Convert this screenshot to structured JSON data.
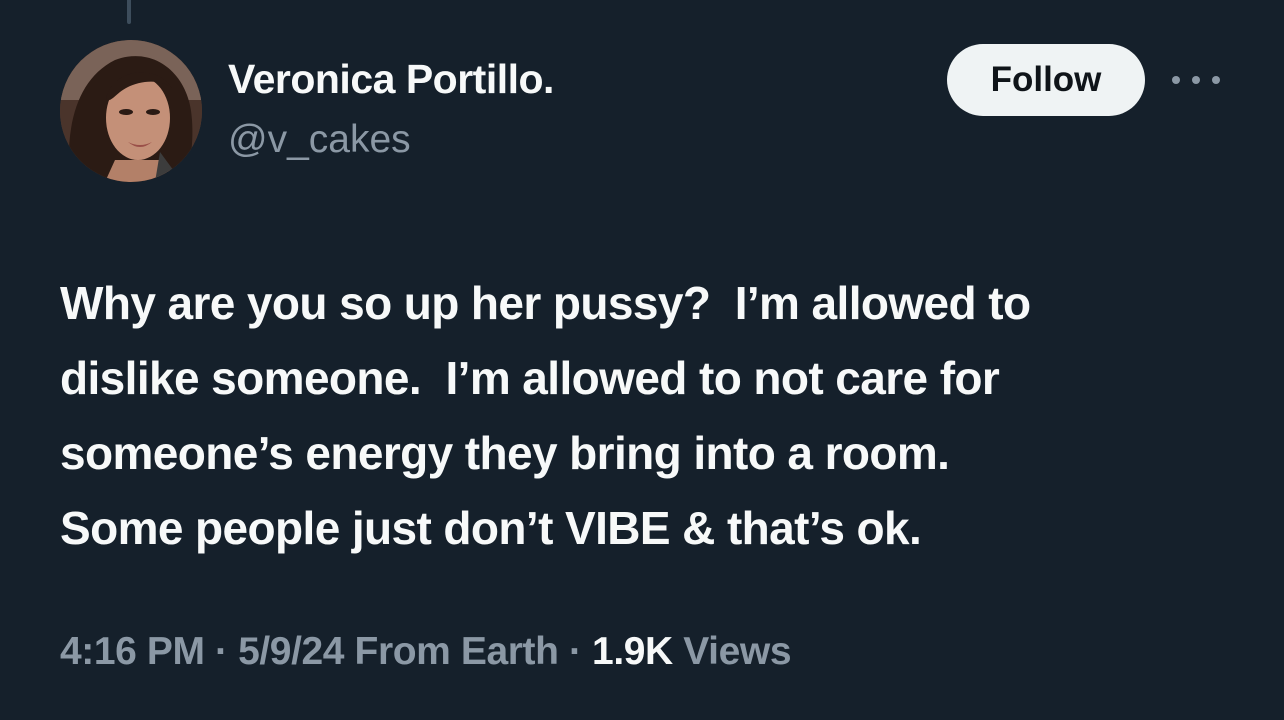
{
  "tweet": {
    "author": {
      "display_name": "Veronica Portillo.",
      "handle": "@v_cakes",
      "avatar_icon": "profile-photo"
    },
    "follow_label": "Follow",
    "more_icon": "more-horizontal-icon",
    "text_lines": [
      "Why are you so up her pussy?  I’m allowed to",
      "dislike someone.  I’m allowed to not care for",
      "someone’s energy they bring into a room.",
      "Some people just don’t VIBE & that’s ok."
    ],
    "meta": {
      "time": "4:16 PM",
      "separator": "·",
      "date": "5/9/24",
      "source": "From Earth",
      "views_count": "1.9K",
      "views_label": "Views"
    }
  },
  "colors": {
    "background": "#15202b",
    "text_primary": "#f7f9f9",
    "text_secondary": "#8b98a5",
    "follow_bg": "#eff3f4",
    "follow_text": "#0f1419"
  }
}
